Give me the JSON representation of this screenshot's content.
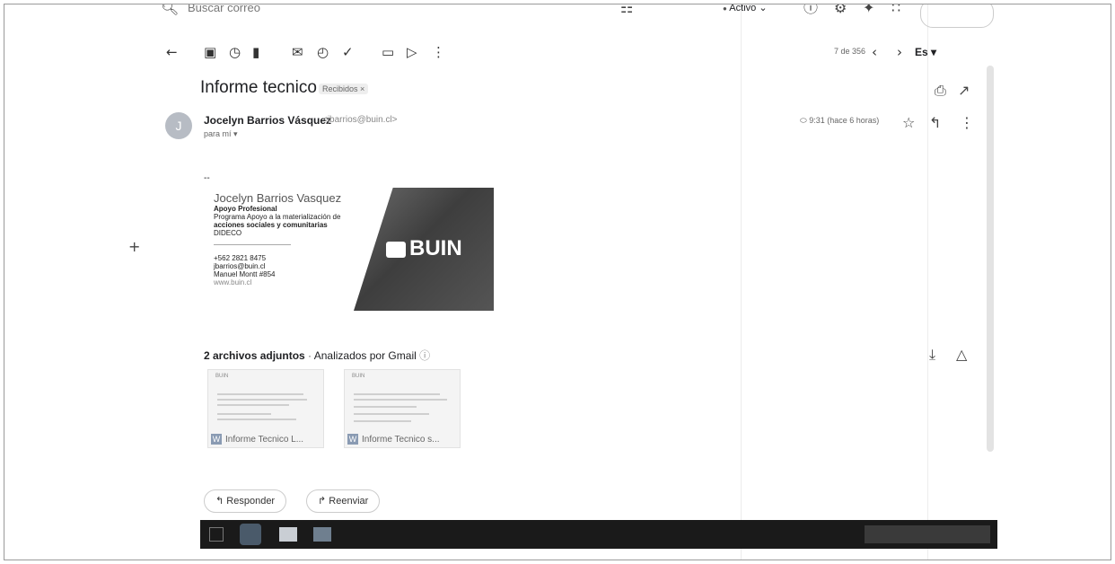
{
  "topbar": {
    "search_placeholder": "Buscar correo",
    "status": "Activo"
  },
  "toolbar": {
    "pagination": "7 de 356",
    "lang": "Es"
  },
  "message": {
    "subject": "Informe tecnico",
    "label": "Recibidos",
    "sender_name": "Jocelyn Barrios Vásquez",
    "sender_email": "<jbarrios@buin.cl>",
    "to": "para mí",
    "time": "9:31 (hace 6 horas)",
    "dash": "--"
  },
  "signature": {
    "name": "Jocelyn Barrios Vasquez",
    "role": "Apoyo Profesional",
    "program_1": "Programa Apoyo a la materialización de",
    "program_2": "acciones sociales y comunitarias",
    "dept": "DIDECO",
    "phone": "+562 2821 8475",
    "email": "jbarrios@buin.cl",
    "address": "Manuel Montt #854",
    "web": "www.buin.cl",
    "logo_text": "BUIN"
  },
  "attachments": {
    "title": "2 archivos adjuntos",
    "scanned": "Analizados por Gmail",
    "items": [
      {
        "label": "Informe Tecnico L...",
        "badge": "W",
        "header": "BUIN"
      },
      {
        "label": "Informe Tecnico s...",
        "badge": "W",
        "header": "BUIN"
      }
    ]
  },
  "actions": {
    "reply": "Responder",
    "forward": "Reenviar"
  }
}
